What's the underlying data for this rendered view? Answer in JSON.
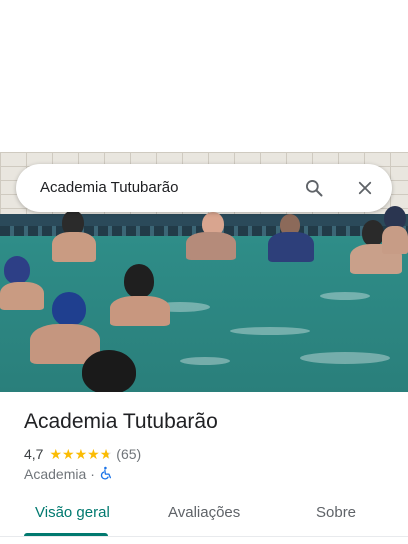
{
  "search": {
    "query": "Academia Tutubarão"
  },
  "place": {
    "name": "Academia Tutubarão",
    "rating": "4,7",
    "rating_value": 4.7,
    "review_count": "(65)",
    "category": "Academia",
    "separator": "·"
  },
  "tabs": [
    {
      "label": "Visão geral",
      "active": true
    },
    {
      "label": "Avaliações",
      "active": false
    },
    {
      "label": "Sobre",
      "active": false
    }
  ],
  "colors": {
    "accent": "#01796f",
    "star": "#fbbc04",
    "accessible_icon": "#1a73e8"
  },
  "icons": {
    "search": "search-icon",
    "close": "close-icon",
    "accessibility": "wheelchair-icon"
  }
}
